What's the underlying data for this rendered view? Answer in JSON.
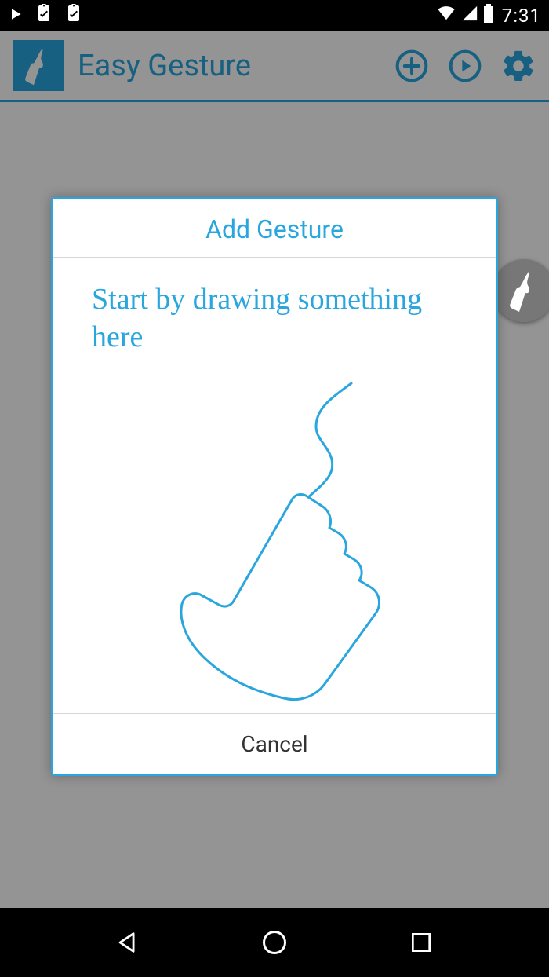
{
  "status_bar": {
    "time": "7:31",
    "icons": {
      "play": "play-icon",
      "clip1": "clipboard-check-icon",
      "clip2": "clipboard-check-icon",
      "wifi": "wifi-icon",
      "signal": "signal-icon",
      "battery": "battery-icon"
    }
  },
  "header": {
    "title": "Easy Gesture",
    "actions": {
      "add": "add-circle-icon",
      "play": "play-circle-icon",
      "settings": "gear-icon"
    }
  },
  "dialog": {
    "title": "Add Gesture",
    "hint": "Start by drawing something here",
    "cancel_label": "Cancel"
  },
  "colors": {
    "accent": "#29a6de"
  },
  "nav": {
    "back": "back-triangle-icon",
    "home": "home-circle-icon",
    "recent": "recent-square-icon"
  }
}
